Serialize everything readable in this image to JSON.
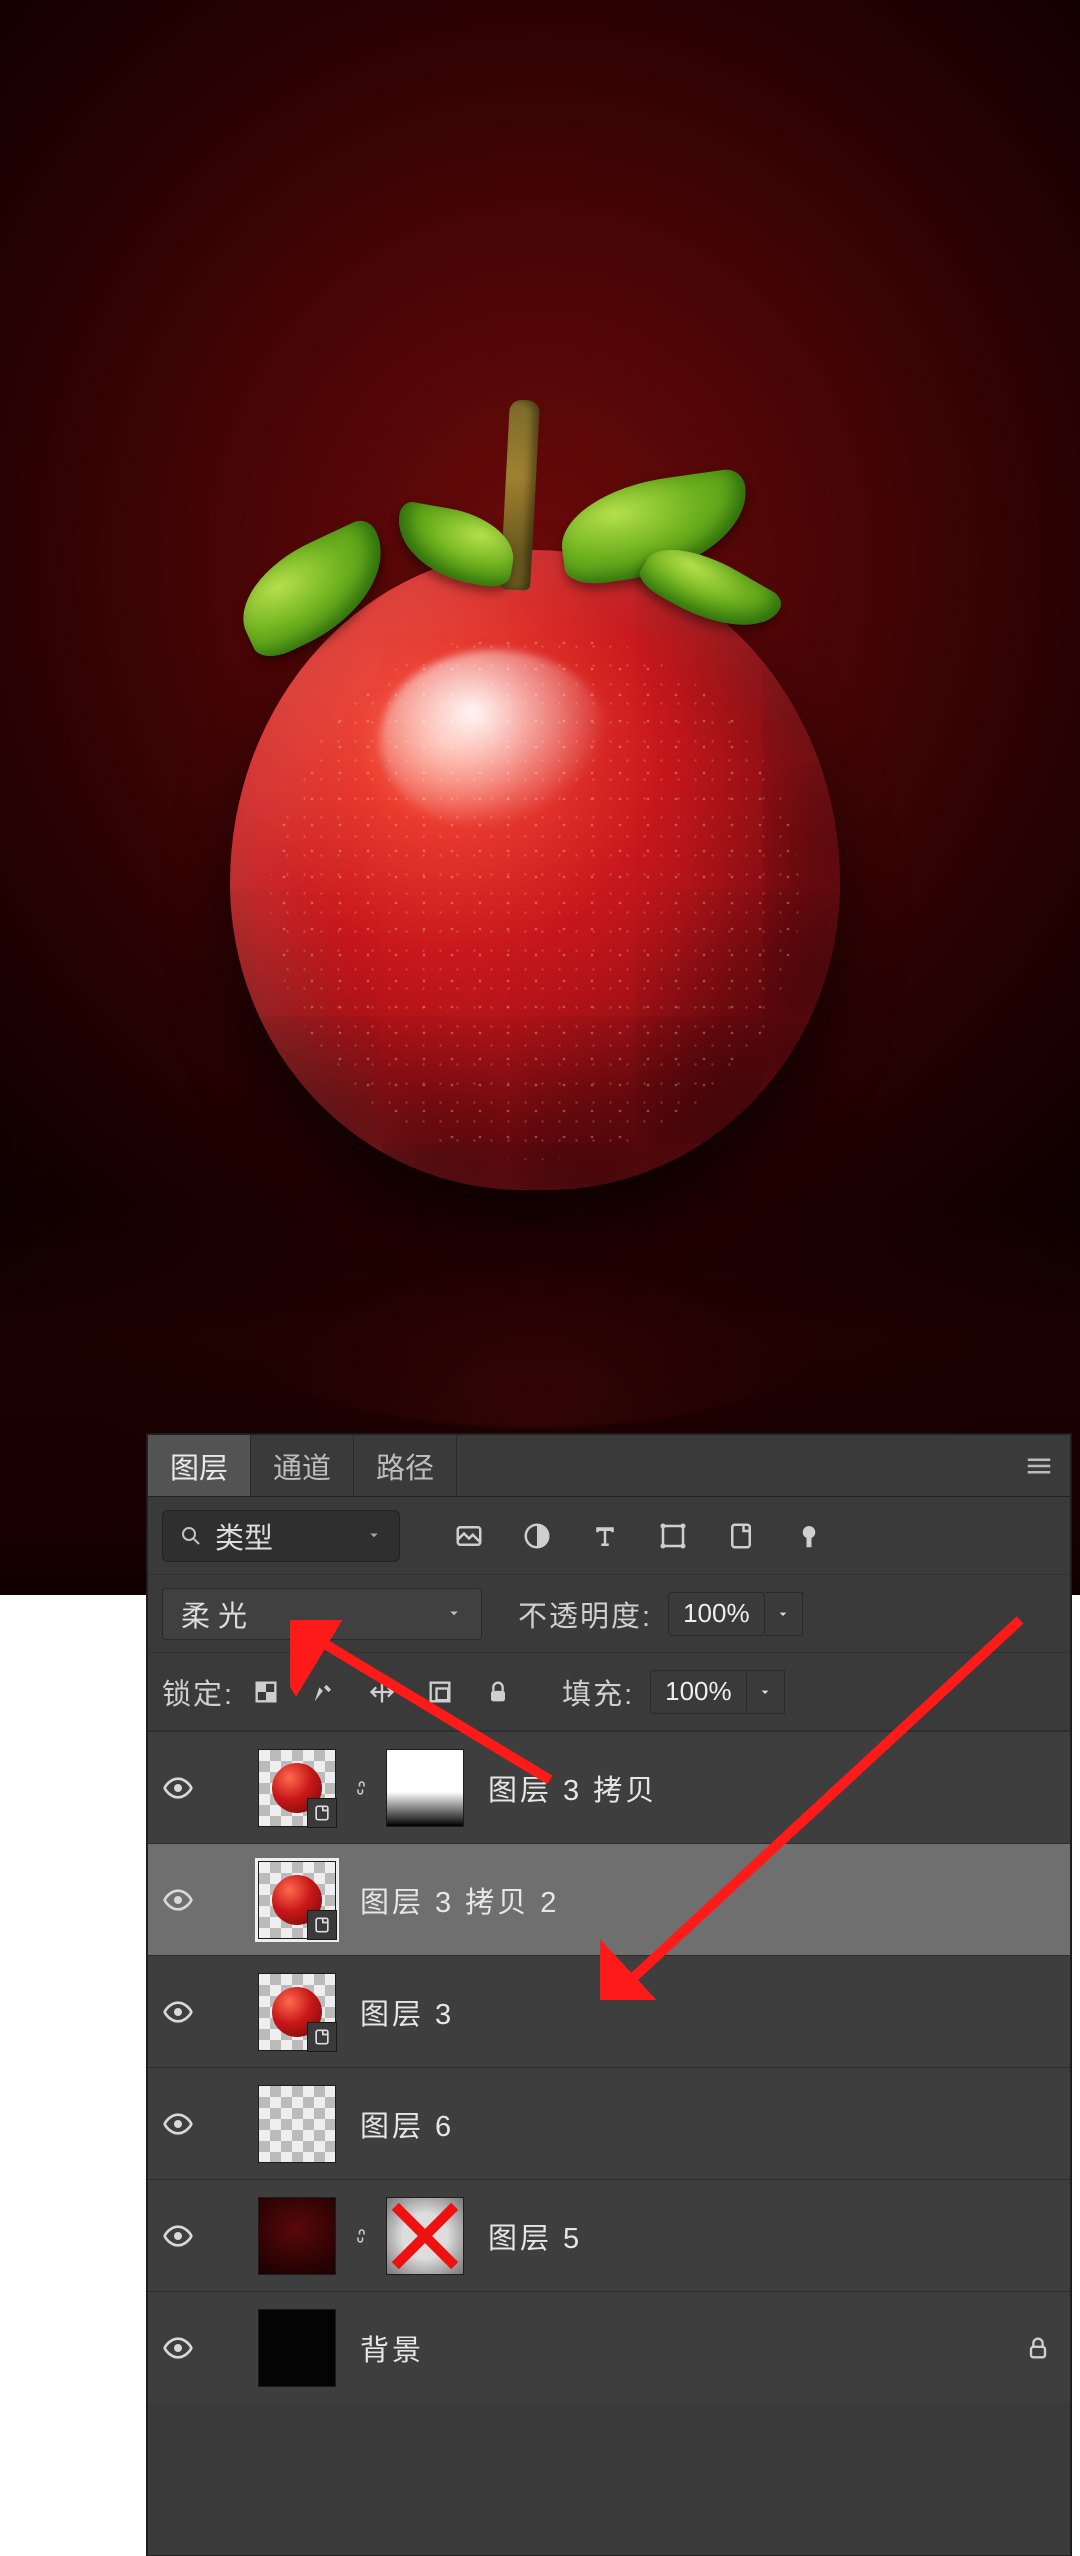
{
  "canvas": {
    "subject": "red-apple-artwork"
  },
  "panel": {
    "tabs": {
      "layers": "图层",
      "channels": "通道",
      "paths": "路径",
      "active": "layers"
    },
    "search": {
      "prefix_icon": "search-icon",
      "label": "类型"
    },
    "filter_icons": [
      "pixel-layer-icon",
      "adjustment-layer-icon",
      "type-layer-icon",
      "shape-layer-icon",
      "smartobject-layer-icon",
      "artboard-icon"
    ],
    "blend_mode": "柔光",
    "opacity": {
      "label": "不透明度:",
      "value": "100%"
    },
    "lock": {
      "label": "锁定:",
      "icons": [
        "lock-transparency-icon",
        "lock-pixels-icon",
        "lock-position-icon",
        "lock-artboard-icon",
        "lock-all-icon"
      ]
    },
    "fill": {
      "label": "填充:",
      "value": "100%"
    },
    "layers": [
      {
        "id": "l0",
        "name": "图层 3 拷贝",
        "visible": true,
        "smart": true,
        "has_mask": true,
        "linked": true,
        "thumb": "apple",
        "mask": "grad"
      },
      {
        "id": "l1",
        "name": "图层 3 拷贝 2",
        "visible": true,
        "smart": true,
        "selected": true,
        "thumb": "apple"
      },
      {
        "id": "l2",
        "name": "图层 3",
        "visible": true,
        "smart": true,
        "thumb": "apple"
      },
      {
        "id": "l3",
        "name": "图层 6",
        "visible": true,
        "thumb": "checker"
      },
      {
        "id": "l4",
        "name": "图层 5",
        "visible": true,
        "has_mask": true,
        "linked": true,
        "thumb": "red",
        "mask": "x"
      },
      {
        "id": "l5",
        "name": "背景",
        "visible": true,
        "locked": true,
        "thumb": "black"
      }
    ]
  },
  "annotations": {
    "arrow1": "points to blend_mode dropdown",
    "arrow2": "points to selected layer"
  }
}
